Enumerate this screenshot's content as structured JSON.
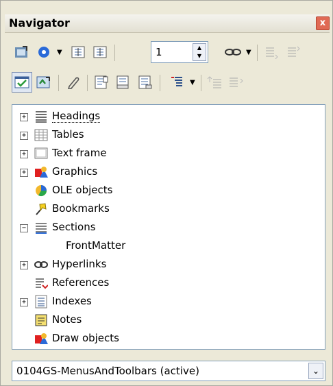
{
  "window": {
    "title": "Navigator",
    "close_glyph": "x"
  },
  "toolbar1": {
    "buttons": [
      "navigation-icon",
      "dot-icon",
      "dropdown-arrow-icon",
      "previous-icon",
      "next-icon"
    ],
    "spinner_value": "1",
    "right_buttons": [
      "link-icon",
      "dropdown-arrow-icon",
      "promote-level-icon",
      "demote-level-icon"
    ]
  },
  "toolbar2": {
    "buttons": [
      "content-view-icon",
      "set-reminder-icon",
      "edit-icon",
      "header-icon",
      "footer-icon",
      "anchor-icon",
      "heading-levels-icon",
      "dropdown-arrow-icon",
      "promote-chapter-icon",
      "demote-chapter-icon"
    ]
  },
  "tree": {
    "items": [
      {
        "label": "Headings",
        "expander": "+",
        "icon": "headings-icon",
        "selected": true
      },
      {
        "label": "Tables",
        "expander": "+",
        "icon": "tables-icon"
      },
      {
        "label": "Text frame",
        "expander": "+",
        "icon": "text-frame-icon"
      },
      {
        "label": "Graphics",
        "expander": "+",
        "icon": "graphics-icon"
      },
      {
        "label": "OLE objects",
        "expander": "",
        "icon": "ole-objects-icon"
      },
      {
        "label": "Bookmarks",
        "expander": "",
        "icon": "bookmarks-icon"
      },
      {
        "label": "Sections",
        "expander": "−",
        "icon": "sections-icon"
      },
      {
        "label": "FrontMatter",
        "expander": "",
        "icon": "",
        "child": true
      },
      {
        "label": "Hyperlinks",
        "expander": "+",
        "icon": "hyperlinks-icon"
      },
      {
        "label": "References",
        "expander": "",
        "icon": "references-icon"
      },
      {
        "label": "Indexes",
        "expander": "+",
        "icon": "indexes-icon"
      },
      {
        "label": "Notes",
        "expander": "",
        "icon": "notes-icon"
      },
      {
        "label": "Draw objects",
        "expander": "",
        "icon": "draw-objects-icon"
      }
    ]
  },
  "document_select": {
    "value": "0104GS-MenusAndToolbars (active)"
  },
  "colors": {
    "accent": "#2a6ad8",
    "selection_border": "#7a8db2"
  }
}
